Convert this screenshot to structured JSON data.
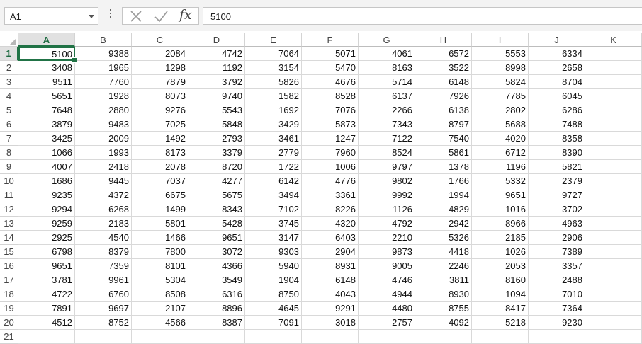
{
  "name_box": {
    "value": "A1"
  },
  "formula_bar": {
    "cancel_icon": "close-x-icon",
    "enter_icon": "checkmark-icon",
    "function_label": "fx",
    "content": "5100"
  },
  "sheet": {
    "active_cell": "A1",
    "columns": [
      "A",
      "B",
      "C",
      "D",
      "E",
      "F",
      "G",
      "H",
      "I",
      "J",
      "K"
    ],
    "row_numbers": [
      "1",
      "2",
      "3",
      "4",
      "5",
      "6",
      "7",
      "8",
      "9",
      "10",
      "11",
      "12",
      "13",
      "14",
      "15",
      "16",
      "17",
      "18",
      "19",
      "20",
      "21"
    ],
    "rows": [
      [
        "5100",
        "9388",
        "2084",
        "4742",
        "7064",
        "5071",
        "4061",
        "6572",
        "5553",
        "6334"
      ],
      [
        "3408",
        "1965",
        "1298",
        "1192",
        "3154",
        "5470",
        "8163",
        "3522",
        "8998",
        "2658"
      ],
      [
        "9511",
        "7760",
        "7879",
        "3792",
        "5826",
        "4676",
        "5714",
        "6148",
        "5824",
        "8704"
      ],
      [
        "5651",
        "1928",
        "8073",
        "9740",
        "1582",
        "8528",
        "6137",
        "7926",
        "7785",
        "6045"
      ],
      [
        "7648",
        "2880",
        "9276",
        "5543",
        "1692",
        "7076",
        "2266",
        "6138",
        "2802",
        "6286"
      ],
      [
        "3879",
        "9483",
        "7025",
        "5848",
        "3429",
        "5873",
        "7343",
        "8797",
        "5688",
        "7488"
      ],
      [
        "3425",
        "2009",
        "1492",
        "2793",
        "3461",
        "1247",
        "7122",
        "7540",
        "4020",
        "8358"
      ],
      [
        "1066",
        "1993",
        "8173",
        "3379",
        "2779",
        "7960",
        "8524",
        "5861",
        "6712",
        "8390"
      ],
      [
        "4007",
        "2418",
        "2078",
        "8720",
        "1722",
        "1006",
        "9797",
        "1378",
        "1196",
        "5821"
      ],
      [
        "1686",
        "9445",
        "7037",
        "4277",
        "6142",
        "4776",
        "9802",
        "1766",
        "5332",
        "2379"
      ],
      [
        "9235",
        "4372",
        "6675",
        "5675",
        "3494",
        "3361",
        "9992",
        "1994",
        "9651",
        "9727"
      ],
      [
        "9294",
        "6268",
        "1499",
        "8343",
        "7102",
        "8226",
        "1126",
        "4829",
        "1016",
        "3702"
      ],
      [
        "9259",
        "2183",
        "5801",
        "5428",
        "3745",
        "4320",
        "4792",
        "2942",
        "8966",
        "4963"
      ],
      [
        "2925",
        "4540",
        "1466",
        "9651",
        "3147",
        "6403",
        "2210",
        "5326",
        "2185",
        "2906"
      ],
      [
        "6798",
        "8379",
        "7800",
        "3072",
        "9303",
        "2904",
        "9873",
        "4418",
        "1026",
        "7389"
      ],
      [
        "9651",
        "7359",
        "8101",
        "4366",
        "5940",
        "8931",
        "9005",
        "2246",
        "2053",
        "3357"
      ],
      [
        "3781",
        "9961",
        "5304",
        "3549",
        "1904",
        "6148",
        "4746",
        "3811",
        "8160",
        "2488"
      ],
      [
        "4722",
        "6760",
        "8508",
        "6316",
        "8750",
        "4043",
        "4944",
        "8930",
        "1094",
        "7010"
      ],
      [
        "7891",
        "9697",
        "2107",
        "8896",
        "4645",
        "9291",
        "4480",
        "8755",
        "8417",
        "7364"
      ],
      [
        "4512",
        "8752",
        "4566",
        "8387",
        "7091",
        "3018",
        "2757",
        "4092",
        "5218",
        "9230"
      ],
      [
        "",
        "",
        "",
        "",
        "",
        "",
        "",
        "",
        "",
        ""
      ]
    ]
  },
  "colors": {
    "accent": "#217346",
    "header_selected_bg": "#e1e1e1",
    "gridline": "#d9d9d9"
  }
}
